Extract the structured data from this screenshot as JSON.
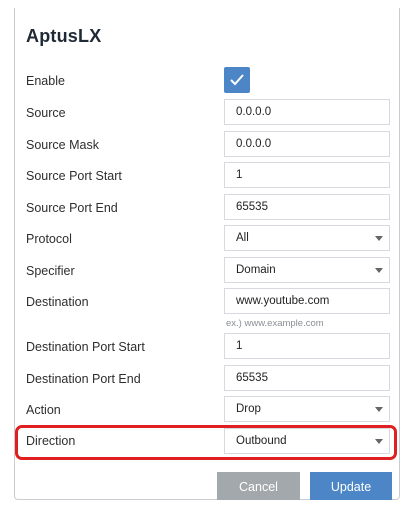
{
  "dialog": {
    "title": "AptusLX"
  },
  "form": {
    "enable": {
      "label": "Enable",
      "checked": true
    },
    "source": {
      "label": "Source",
      "value": "0.0.0.0"
    },
    "source_mask": {
      "label": "Source Mask",
      "value": "0.0.0.0"
    },
    "source_port_start": {
      "label": "Source Port Start",
      "value": "1"
    },
    "source_port_end": {
      "label": "Source Port End",
      "value": "65535"
    },
    "protocol": {
      "label": "Protocol",
      "value": "All"
    },
    "specifier": {
      "label": "Specifier",
      "value": "Domain"
    },
    "destination": {
      "label": "Destination",
      "value": "www.youtube.com",
      "hint": "ex.) www.example.com"
    },
    "destination_port_start": {
      "label": "Destination Port Start",
      "value": "1"
    },
    "destination_port_end": {
      "label": "Destination Port End",
      "value": "65535"
    },
    "action": {
      "label": "Action",
      "value": "Drop"
    },
    "direction": {
      "label": "Direction",
      "value": "Outbound"
    }
  },
  "buttons": {
    "cancel": "Cancel",
    "update": "Update"
  },
  "colors": {
    "accent": "#4c86c6",
    "cancel_gray": "#a3a8ad",
    "highlight_red": "#e02020"
  }
}
